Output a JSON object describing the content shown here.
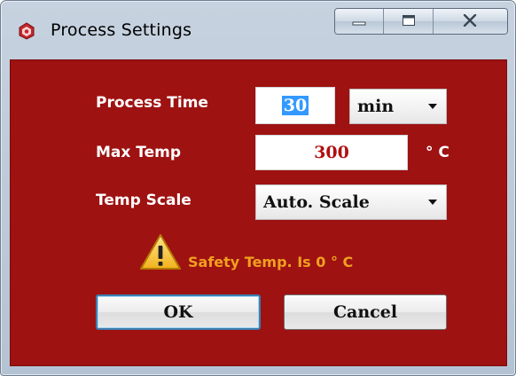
{
  "window": {
    "title": "Process Settings",
    "icon": "app-icon",
    "caption_buttons": [
      "minimize",
      "maximize",
      "close"
    ]
  },
  "form": {
    "process_time": {
      "label": "Process Time",
      "value": "30",
      "unit_selected": "min"
    },
    "max_temp": {
      "label": "Max Temp",
      "value": "300",
      "unit": "° C"
    },
    "temp_scale": {
      "label": "Temp Scale",
      "selected": "Auto. Scale"
    }
  },
  "warning": {
    "text": "Safety Temp. Is 0 ° C",
    "icon": "warning-icon"
  },
  "buttons": {
    "ok_label": "OK",
    "cancel_label": "Cancel"
  },
  "colors": {
    "client_bg": "#9e1212",
    "label": "#ffffff",
    "input_text": "#b01010",
    "warning_text": "#f0a020",
    "title_bar": "#c6d2df"
  }
}
